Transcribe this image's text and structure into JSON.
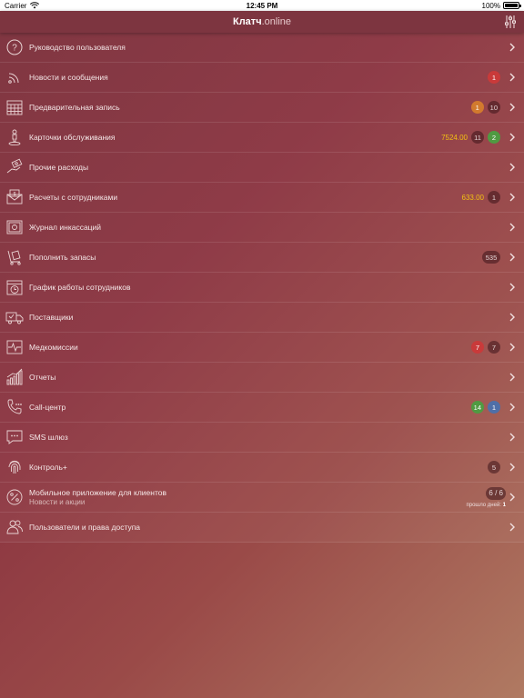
{
  "statusbar": {
    "carrier": "Carrier",
    "time": "12:45 PM",
    "battery": "100%"
  },
  "navbar": {
    "title_bold": "Клатч",
    "title_thin": ".online"
  },
  "menu": [
    {
      "label": "Руководство пользователя",
      "icon": "help-circle-icon"
    },
    {
      "label": "Новости и сообщения",
      "icon": "rss-icon",
      "badges": [
        {
          "value": "1",
          "color": "red"
        }
      ]
    },
    {
      "label": "Предварительная запись",
      "icon": "calendar-icon",
      "badges": [
        {
          "value": "1",
          "color": "orange"
        },
        {
          "value": "10",
          "color": "dark"
        }
      ]
    },
    {
      "label": "Карточки обслуживания",
      "icon": "person-map-pin-icon",
      "amount": "7524.00",
      "badges": [
        {
          "value": "11",
          "color": "dark"
        },
        {
          "value": "2",
          "color": "green"
        }
      ]
    },
    {
      "label": "Прочие расходы",
      "icon": "money-hand-icon"
    },
    {
      "label": "Расчеты с сотрудниками",
      "icon": "money-envelope-icon",
      "amount": "633.00",
      "badges": [
        {
          "value": "1",
          "color": "dark"
        }
      ]
    },
    {
      "label": "Журнал инкассаций",
      "icon": "safe-icon"
    },
    {
      "label": "Пополнить запасы",
      "icon": "cart-box-icon",
      "badges": [
        {
          "value": "535",
          "color": "dark"
        }
      ]
    },
    {
      "label": "График работы сотрудников",
      "icon": "calendar-clock-icon"
    },
    {
      "label": "Поставщики",
      "icon": "delivery-truck-icon"
    },
    {
      "label": "Медкомиссии",
      "icon": "heartbeat-icon",
      "badges": [
        {
          "value": "7",
          "color": "red"
        },
        {
          "value": "7",
          "color": "dark"
        }
      ]
    },
    {
      "label": "Отчеты",
      "icon": "bar-chart-icon"
    },
    {
      "label": "Call-центр",
      "icon": "phone-dots-icon",
      "badges": [
        {
          "value": "14",
          "color": "green"
        },
        {
          "value": "1",
          "color": "blue"
        }
      ]
    },
    {
      "label": "SMS шлюз",
      "icon": "chat-bubble-icon"
    },
    {
      "label": "Контроль+",
      "icon": "fingerprint-icon",
      "badges": [
        {
          "value": "5",
          "color": "dark"
        }
      ]
    },
    {
      "label": "Мобильное приложение для клиентов",
      "sublabel": "Новости и акции",
      "icon": "percent-circle-icon",
      "count": "6 / 6",
      "days_label": "прошло дней:",
      "days_value": "1"
    },
    {
      "label": "Пользователи и права доступа",
      "icon": "users-icon"
    }
  ]
}
